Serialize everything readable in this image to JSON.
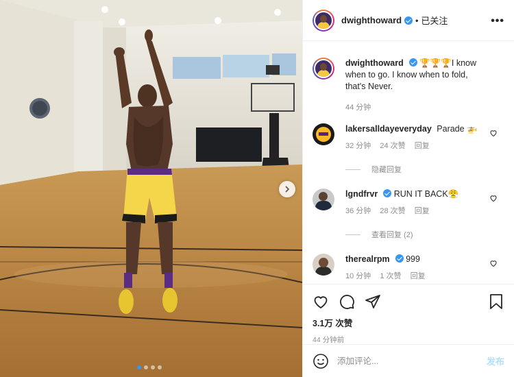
{
  "post": {
    "username": "dwighthoward",
    "follow_state": "已关注",
    "separator": "•",
    "more_label": "•••",
    "caption": "🏆🏆🏆I know when to go. I know when to fold, that's Never.",
    "caption_time": "44 分钟",
    "likes": "3.1万 次赞",
    "post_time": "44 分钟前",
    "carousel_total": 4,
    "carousel_active": 0
  },
  "comments": [
    {
      "username": "lakersalldayeveryday",
      "text": "Parade 🚁",
      "time": "32 分钟",
      "likes": "24 次赞",
      "reply": "回复",
      "replies_label": "隐藏回复",
      "verified": false
    },
    {
      "username": "lgndfrvr",
      "text": "RUN IT BACK😤",
      "time": "36 分钟",
      "likes": "28 次赞",
      "reply": "回复",
      "replies_label": "查看回复 (2)",
      "verified": true
    },
    {
      "username": "therealrpm",
      "text": "999",
      "time": "10 分钟",
      "likes": "1 次赞",
      "reply": "回复",
      "verified": true
    }
  ],
  "composer": {
    "placeholder": "添加评论...",
    "post_label": "发布"
  },
  "icons": {
    "like": "heart-icon",
    "comment": "comment-icon",
    "share": "paper-plane-icon",
    "save": "bookmark-icon",
    "emoji": "smiley-icon",
    "next": "chevron-right-icon"
  },
  "colors": {
    "accent": "#3897f0",
    "post_button_disabled": "#b2dffc",
    "muted_text": "#8e8e8e"
  }
}
